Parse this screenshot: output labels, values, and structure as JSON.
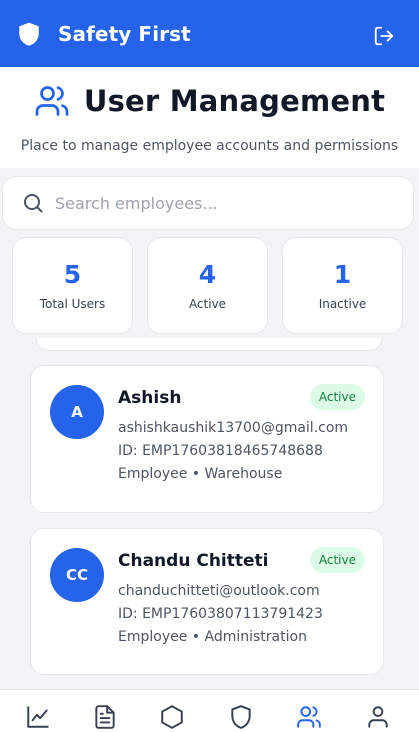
{
  "app": {
    "title": "Safety First"
  },
  "page": {
    "title": "User Management",
    "subtitle": "Place to manage employee accounts and permissions"
  },
  "search": {
    "placeholder": "Search employees..."
  },
  "stats": [
    {
      "value": "5",
      "label": "Total Users"
    },
    {
      "value": "4",
      "label": "Active"
    },
    {
      "value": "1",
      "label": "Inactive"
    }
  ],
  "users": [
    {
      "initials": "A",
      "name": "Ashish",
      "email": "ashishkaushik13700@gmail.com",
      "id": "ID: EMP17603818465748688",
      "role_dept": "Employee • Warehouse",
      "status": "Active"
    },
    {
      "initials": "CC",
      "name": "Chandu Chitteti",
      "email": "chanduchitteti@outlook.com",
      "id": "ID: EMP17603807113791423",
      "role_dept": "Employee • Administration",
      "status": "Active"
    }
  ],
  "nav": {
    "items": [
      {
        "icon": "chart-icon"
      },
      {
        "icon": "document-icon"
      },
      {
        "icon": "hexagon-icon"
      },
      {
        "icon": "shield-icon"
      },
      {
        "icon": "users-icon",
        "active": true
      },
      {
        "icon": "user-icon"
      }
    ]
  },
  "colors": {
    "primary": "#2563eb",
    "active_badge_bg": "#dcfce7",
    "active_badge_text": "#15803d",
    "nav_inactive": "#374151"
  }
}
